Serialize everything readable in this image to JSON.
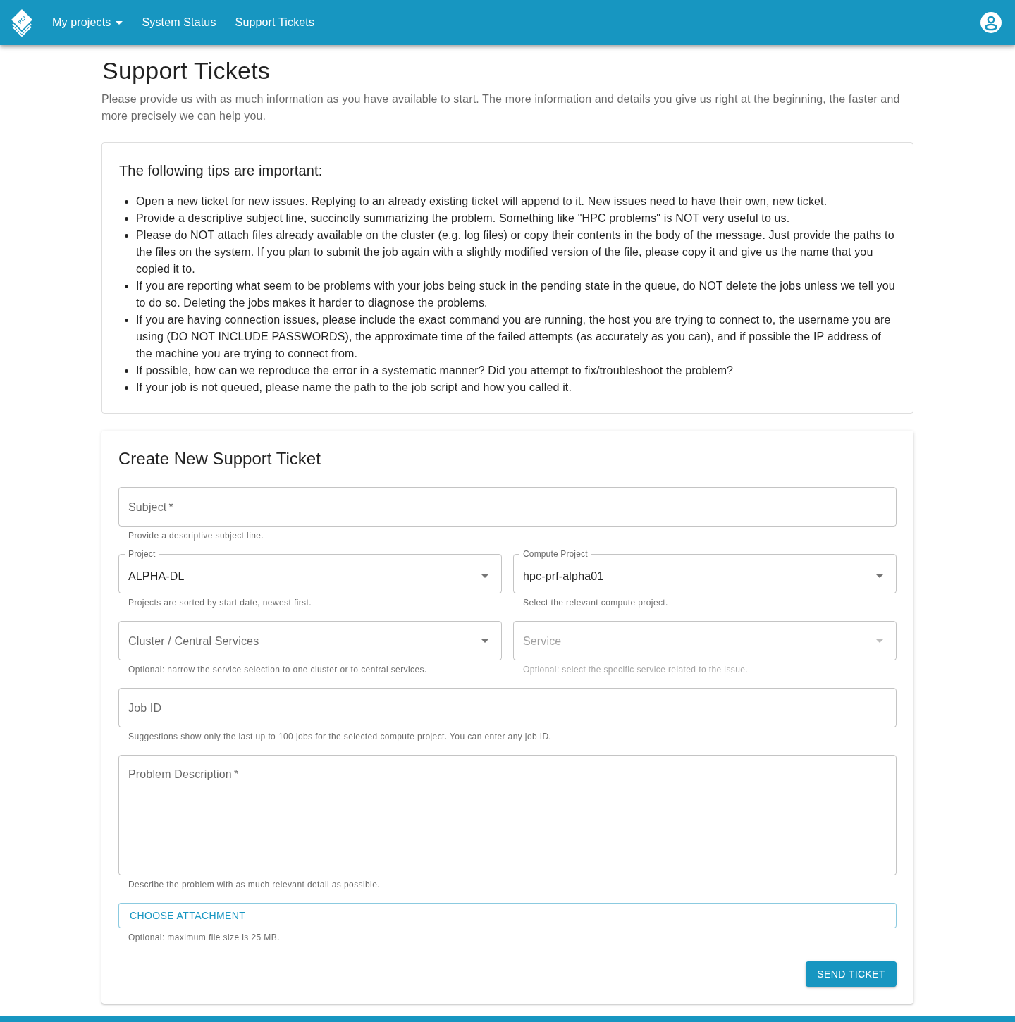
{
  "navbar": {
    "logo_text": "PC²",
    "menu": [
      {
        "label": "My projects",
        "dropdown": true
      },
      {
        "label": "System Status",
        "dropdown": false
      },
      {
        "label": "Support Tickets",
        "dropdown": false
      }
    ]
  },
  "page": {
    "title": "Support Tickets",
    "intro": "Please provide us with as much information as you have available to start. The more information and details you give us right at the beginning, the faster and more precisely we can help you."
  },
  "tips": {
    "heading": "The following tips are important:",
    "items": [
      "Open a new ticket for new issues. Replying to an already existing ticket will append to it. New issues need to have their own, new ticket.",
      "Provide a descriptive subject line, succinctly summarizing the problem. Something like \"HPC problems\" is NOT very useful to us.",
      "Please do NOT attach files already available on the cluster (e.g. log files) or copy their contents in the body of the message. Just provide the paths to the files on the system. If you plan to submit the job again with a slightly modified version of the file, please copy it and give us the name that you copied it to.",
      "If you are reporting what seem to be problems with your jobs being stuck in the pending state in the queue, do NOT delete the jobs unless we tell you to do so. Deleting the jobs makes it harder to diagnose the problems.",
      "If you are having connection issues, please include the exact command you are running, the host you are trying to connect to, the username you are using (DO NOT INCLUDE PASSWORDS), the approximate time of the failed attempts (as accurately as you can), and if possible the IP address of the machine you are trying to connect from.",
      "If possible, how can we reproduce the error in a systematic manner? Did you attempt to fix/troubleshoot the problem?",
      "If your job is not queued, please name the path to the job script and how you called it."
    ]
  },
  "form": {
    "title": "Create New Support Ticket",
    "rows": [
      [
        {
          "kind": "text",
          "label": "Subject",
          "required_mark": "*",
          "disabled": false,
          "helper": "Provide a descriptive subject line."
        }
      ],
      [
        {
          "kind": "select",
          "label": "Project",
          "value": "ALPHA-DL",
          "disabled": false,
          "helper": "Projects are sorted by start date, newest first."
        },
        {
          "kind": "select",
          "label": "Compute Project",
          "value": "hpc-prf-alpha01",
          "disabled": false,
          "helper": "Select the relevant compute project."
        }
      ],
      [
        {
          "kind": "select",
          "label": "Cluster / Central Services",
          "disabled": false,
          "helper": "Optional: narrow the service selection to one cluster or to central services."
        },
        {
          "kind": "select",
          "label": "Service",
          "disabled": true,
          "helper": "Optional: select the specific service related to the issue."
        }
      ],
      [
        {
          "kind": "text",
          "label": "Job ID",
          "disabled": false,
          "helper": "Suggestions show only the last up to 100 jobs for the selected compute project. You can enter any job ID."
        }
      ],
      [
        {
          "kind": "textarea",
          "label": "Problem Description",
          "required_mark": "*",
          "disabled": false,
          "helper": "Describe the problem with as much relevant detail as possible."
        }
      ]
    ],
    "attachment": {
      "label": "CHOOSE ATTACHMENT",
      "helper": "Optional: maximum file size is 25 MB."
    },
    "submit": {
      "label": "SEND TICKET"
    }
  }
}
